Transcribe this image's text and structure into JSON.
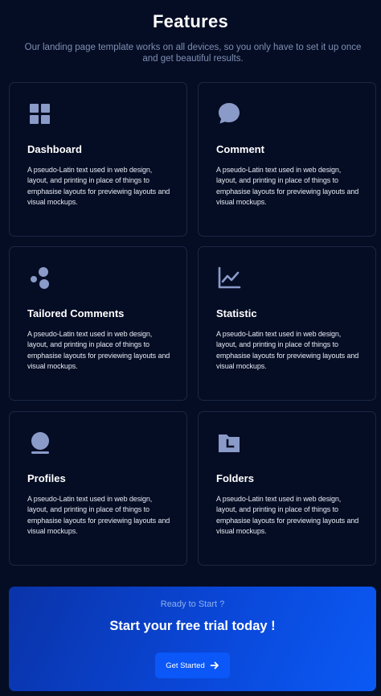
{
  "header": {
    "title": "Features",
    "subtitle": "Our landing page template works on all devices, so you only have to set it up once and get beautiful results."
  },
  "features": [
    {
      "title": "Dashboard",
      "icon": "dashboard-icon",
      "text": "A pseudo-Latin text used in web design, layout, and printing in place of things to emphasise layouts for previewing layouts and visual mockups."
    },
    {
      "title": "Comment",
      "icon": "comment-icon",
      "text": "A pseudo-Latin text used in web design, layout, and printing in place of things to emphasise layouts for previewing layouts and visual mockups."
    },
    {
      "title": "Tailored Comments",
      "icon": "bubbles-icon",
      "text": "A pseudo-Latin text used in web design, layout, and printing in place of things to emphasise layouts for previewing layouts and visual mockups."
    },
    {
      "title": "Statistic",
      "icon": "chart-line-icon",
      "text": "A pseudo-Latin text used in web design, layout, and printing in place of things to emphasise layouts for previewing layouts and visual mockups."
    },
    {
      "title": "Profiles",
      "icon": "profile-icon",
      "text": "A pseudo-Latin text used in web design, layout, and printing in place of things to emphasise layouts for previewing layouts and visual mockups."
    },
    {
      "title": "Folders",
      "icon": "folder-clock-icon",
      "text": "A pseudo-Latin text used in web design, layout, and printing in place of things to emphasise layouts for previewing layouts and visual mockups."
    }
  ],
  "cta": {
    "kicker": "Ready to Start ?",
    "headline": "Start your free trial today !",
    "button_label": "Get Started",
    "button_icon": "arrow-right-icon"
  },
  "colors": {
    "background": "#050d24",
    "icon": "#8a9bc9",
    "card_border": "#1b2744",
    "accent": "#0b57f7"
  }
}
